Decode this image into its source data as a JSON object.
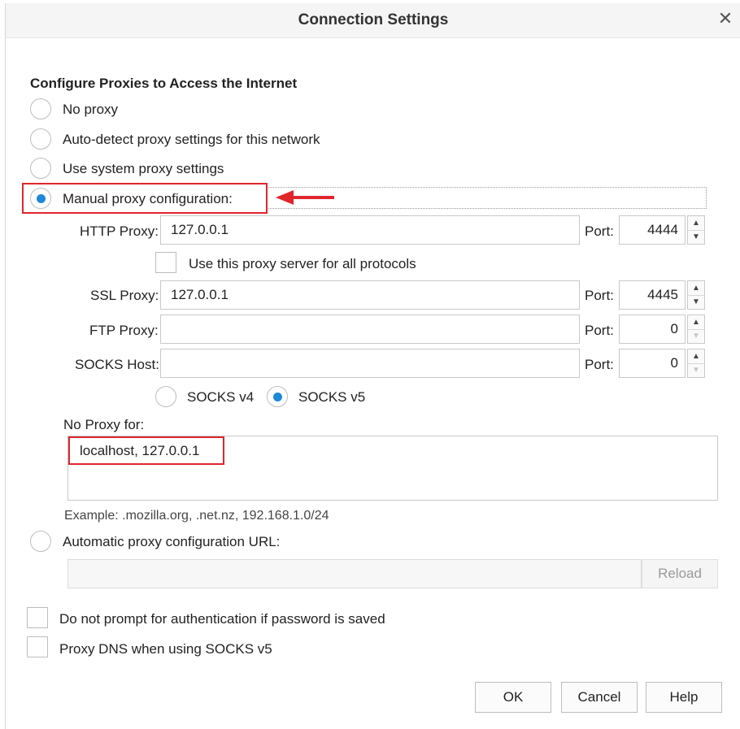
{
  "dialog": {
    "title": "Connection Settings",
    "close_glyph": "✕"
  },
  "section_heading": "Configure Proxies to Access the Internet",
  "options": {
    "no_proxy": "No proxy",
    "auto_detect": "Auto-detect proxy settings for this network",
    "system": "Use system proxy settings",
    "manual": "Manual proxy configuration:",
    "selected": "manual"
  },
  "http": {
    "label": "HTTP Proxy:",
    "value": "127.0.0.1",
    "port_label": "Port:",
    "port": "4444"
  },
  "use_for_all": {
    "label": "Use this proxy server for all protocols",
    "checked": false
  },
  "ssl": {
    "label": "SSL Proxy:",
    "value": "127.0.0.1",
    "port_label": "Port:",
    "port": "4445"
  },
  "ftp": {
    "label": "FTP Proxy:",
    "value": "",
    "port_label": "Port:",
    "port": "0"
  },
  "socks": {
    "label": "SOCKS Host:",
    "value": "",
    "port_label": "Port:",
    "port": "0",
    "v4_label": "SOCKS v4",
    "v5_label": "SOCKS v5",
    "selected_version": "v5"
  },
  "no_proxy_for": {
    "label": "No Proxy for:",
    "value": "localhost, 127.0.0.1",
    "example": "Example: .mozilla.org, .net.nz, 192.168.1.0/24"
  },
  "auto_config": {
    "label": "Automatic proxy configuration URL:",
    "value": "",
    "reload_label": "Reload"
  },
  "checkboxes": {
    "no_prompt_auth": "Do not prompt for authentication if password is saved",
    "proxy_dns": "Proxy DNS when using SOCKS v5"
  },
  "buttons": {
    "ok": "OK",
    "cancel": "Cancel",
    "help": "Help"
  },
  "spinner_glyphs": {
    "up": "▲",
    "down": "▼"
  },
  "colors": {
    "annotation_red": "#e0262c",
    "radio_selected": "#1e88d9"
  }
}
